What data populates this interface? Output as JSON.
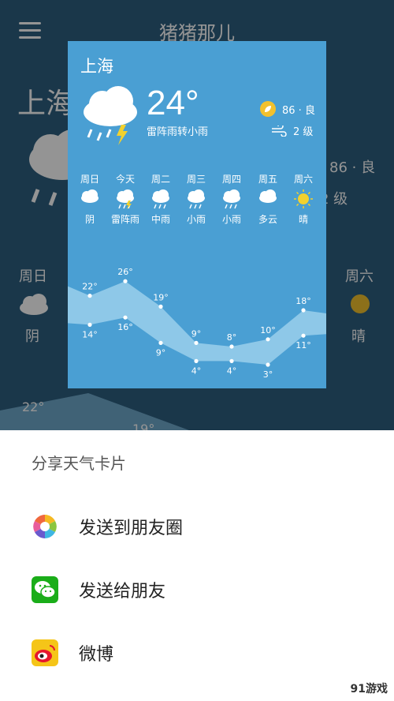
{
  "app": {
    "title": "猪猪那儿",
    "city": "上海",
    "aqi": "86 · 良",
    "wind": "2 级",
    "left_day": "周日",
    "left_cond": "阴",
    "right_day": "周六",
    "right_cond": "晴",
    "temp_low_left": "22°",
    "temp_19": "19°"
  },
  "card": {
    "city": "上海",
    "temperature": "24°",
    "condition": "雷阵雨转小雨",
    "aqi": "86 · 良",
    "wind": "2 级",
    "days": [
      {
        "name": "周日",
        "cond": "阴",
        "icon": "overcast-icon"
      },
      {
        "name": "今天",
        "cond": "雷阵雨",
        "icon": "thunderstorm-icon"
      },
      {
        "name": "周二",
        "cond": "中雨",
        "icon": "moderate-rain-icon"
      },
      {
        "name": "周三",
        "cond": "小雨",
        "icon": "light-rain-icon"
      },
      {
        "name": "周四",
        "cond": "小雨",
        "icon": "light-rain-icon"
      },
      {
        "name": "周五",
        "cond": "多云",
        "icon": "partly-cloudy-icon"
      },
      {
        "name": "周六",
        "cond": "晴",
        "icon": "sunny-icon"
      }
    ],
    "high_temps": [
      22,
      26,
      19,
      9,
      8,
      10,
      18
    ],
    "low_temps": [
      14,
      16,
      9,
      4,
      4,
      3,
      11
    ]
  },
  "share": {
    "title": "分享天气卡片",
    "options": [
      {
        "label": "发送到朋友圈",
        "icon": "moments-icon"
      },
      {
        "label": "发送给朋友",
        "icon": "wechat-icon"
      },
      {
        "label": "微博",
        "icon": "weibo-icon"
      }
    ]
  },
  "watermark": "91游戏",
  "colors": {
    "card_bg": "#4a9fd3",
    "band": "#8ec8e8",
    "wechat_green": "#1aad19",
    "weibo_red": "#e6162d",
    "aqi_badge": "#f2c12e"
  }
}
